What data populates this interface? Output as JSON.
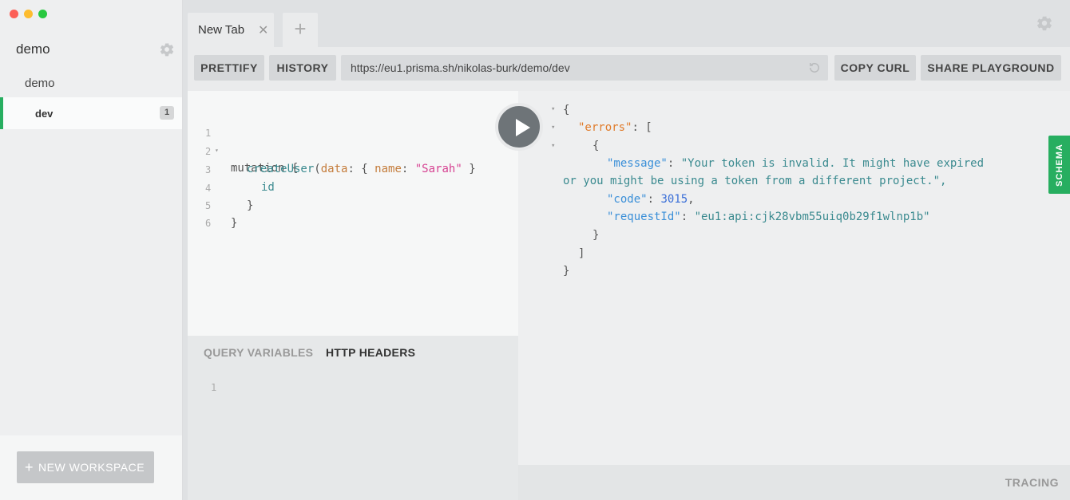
{
  "window": {
    "colors": {
      "close": "#fc5f57",
      "minimize": "#fdbc2e",
      "zoom": "#28c840"
    }
  },
  "sidebar": {
    "workspace_title": "demo",
    "settings_icon": "gear-icon",
    "project_title": "demo",
    "stages": [
      {
        "name": "dev",
        "count": "1",
        "active": true
      }
    ],
    "new_workspace_label": "NEW WORKSPACE",
    "accent_color": "#27ae60"
  },
  "tabs": [
    {
      "label": "New Tab",
      "close_icon": "close-icon"
    }
  ],
  "toolbar": {
    "prettify_label": "PRETTIFY",
    "history_label": "HISTORY",
    "url": "https://eu1.prisma.sh/nikolas-burk/demo/dev",
    "copy_curl_label": "COPY CURL",
    "share_label": "SHARE PLAYGROUND"
  },
  "query_editor": {
    "line_numbers": [
      "1",
      "2",
      "3",
      "4",
      "5",
      "6"
    ],
    "lines": {
      "l1_kw": "mutation",
      "l1_brace": " {",
      "l2_fn": "createUser",
      "l2_open": "(",
      "l2_arg": "data",
      "l2_colon": ": { ",
      "l2_field": "name",
      "l2_colon2": ": ",
      "l2_str": "\"Sarah\"",
      "l2_close": " }",
      "l3_field": "id",
      "l4": "}",
      "l5": "}"
    }
  },
  "variables_panel": {
    "tab_query_variables": "QUERY VARIABLES",
    "tab_http_headers": "HTTP HEADERS",
    "line_numbers": [
      "1"
    ]
  },
  "result": {
    "open_brace": "{",
    "errors_key": "\"errors\"",
    "errors_open": ": [",
    "obj_open": "{",
    "message_key": "\"message\"",
    "message_value_1": "\"Your token is invalid. It might have expired",
    "message_value_2": "or you might be using a token from a different project.\",",
    "code_key": "\"code\"",
    "code_value": "3015",
    "request_key": "\"requestId\"",
    "request_value": "\"eu1:api:cjk28vbm55uiq0b29f1wlnp1b\"",
    "obj_close": "}",
    "errors_close": "]",
    "close_brace": "}"
  },
  "schema_tab_label": "SCHEMA",
  "tracing_label": "TRACING"
}
